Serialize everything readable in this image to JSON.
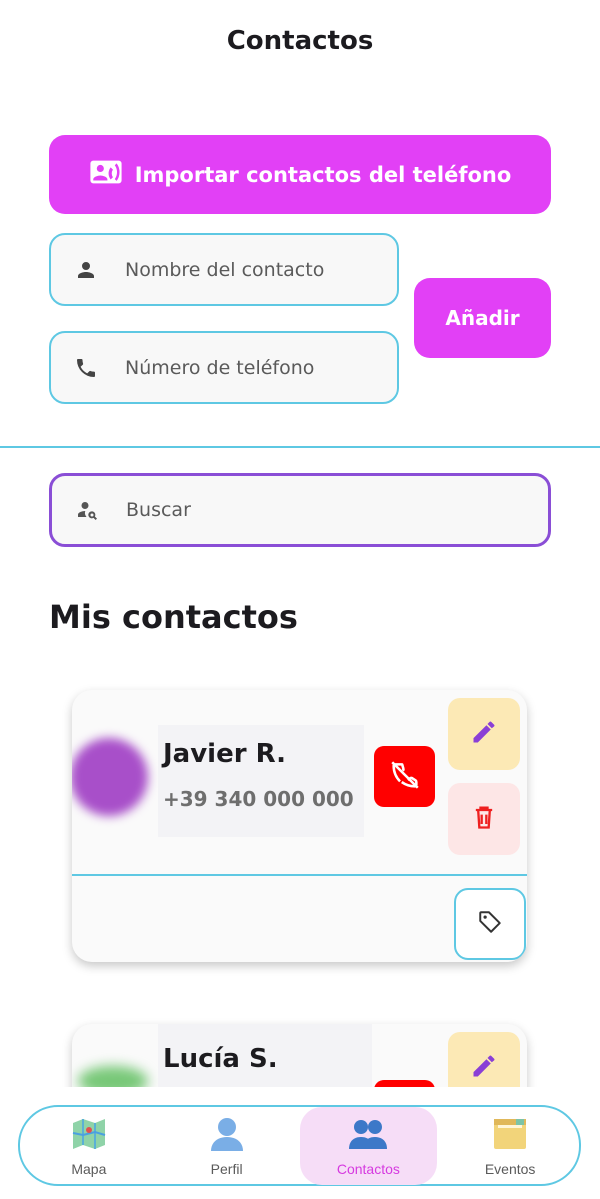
{
  "header": {
    "title": "Contactos"
  },
  "import_button": {
    "label": "Importar contactos del teléfono"
  },
  "form": {
    "name_placeholder": "Nombre del contacto",
    "phone_placeholder": "Número de teléfono",
    "add_label": "Añadir"
  },
  "search": {
    "placeholder": "Buscar"
  },
  "section": {
    "title": "Mis contactos"
  },
  "contacts": [
    {
      "name": "Javier R.",
      "phone": "+39 340 000 000",
      "avatar_color": "#a84fc9"
    },
    {
      "name": "Lucía S.",
      "phone": "",
      "avatar_color": "#78c878"
    }
  ],
  "nav": {
    "items": [
      {
        "label": "Mapa",
        "icon": "map-icon"
      },
      {
        "label": "Perfil",
        "icon": "person-icon"
      },
      {
        "label": "Contactos",
        "icon": "people-icon",
        "active": true
      },
      {
        "label": "Eventos",
        "icon": "folder-icon"
      }
    ]
  },
  "colors": {
    "primary": "#e240f6",
    "accent_border": "#5ec8e3",
    "search_border": "#8a4ed6",
    "danger": "#ff0000",
    "edit_bg": "#fce9b5",
    "edit_icon": "#8a3fd6"
  }
}
